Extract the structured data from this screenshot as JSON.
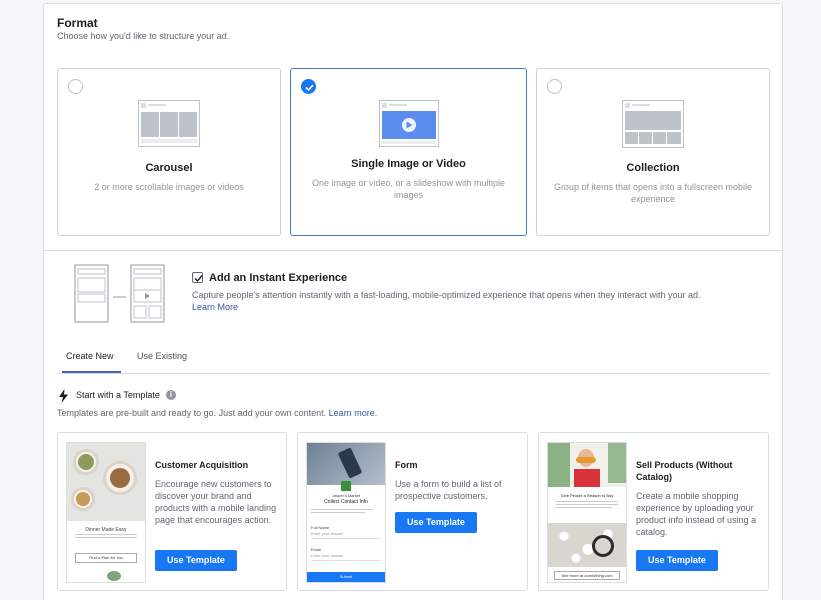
{
  "format": {
    "title": "Format",
    "subtitle": "Choose how you'd like to structure your ad.",
    "options": [
      {
        "title": "Carousel",
        "description": "2 or more scrollable images or videos",
        "selected": false
      },
      {
        "title": "Single Image or Video",
        "description": "One image or video, or a slideshow with multiple images",
        "selected": true
      },
      {
        "title": "Collection",
        "description": "Group of items that opens into a fullscreen mobile experience",
        "selected": false
      }
    ]
  },
  "instant_experience": {
    "checked": true,
    "title": "Add an Instant Experience",
    "description": "Capture people's attention instantly with a fast-loading, mobile-optimized experience that opens when they interact with your ad.",
    "learn_more": "Learn More"
  },
  "tabs": [
    {
      "label": "Create New",
      "active": true
    },
    {
      "label": "Use Existing",
      "active": false
    }
  ],
  "templates": {
    "heading": "Start with a Template",
    "info_glyph": "i",
    "description": "Templates are pre-built and ready to go. Just add your own content.",
    "learn_more": "Learn more.",
    "items": [
      {
        "name": "Customer Acquisition",
        "description": "Encourage new customers to discover your brand and products with a mobile landing page that encourages action.",
        "button": "Use Template",
        "thumb_text": [
          "Dinner Made Easy",
          "Find a Plan for You"
        ]
      },
      {
        "name": "Form",
        "description": "Use a form to build a list of prospective customers.",
        "button": "Use Template",
        "thumb_text": [
          "Jasper's Market",
          "Collect Contact Info",
          "Full Name",
          "Enter your answer",
          "Email",
          "Enter your answer",
          "Submit"
        ]
      },
      {
        "name": "Sell Products (Without Catalog)",
        "description": "Create a mobile shopping experience by uploading your product info instead of using a catalog.",
        "button": "Use Template",
        "thumb_text": [
          "Give People a Reason to Buy",
          "See more at ourclothing.com"
        ]
      }
    ]
  },
  "colors": {
    "accent": "#1877f2",
    "link": "#385898",
    "selected_border": "#4a78d0"
  },
  "icons": {
    "selected_check": "check-icon",
    "template_heading": "lightning-bolt-icon",
    "info": "info-icon"
  }
}
